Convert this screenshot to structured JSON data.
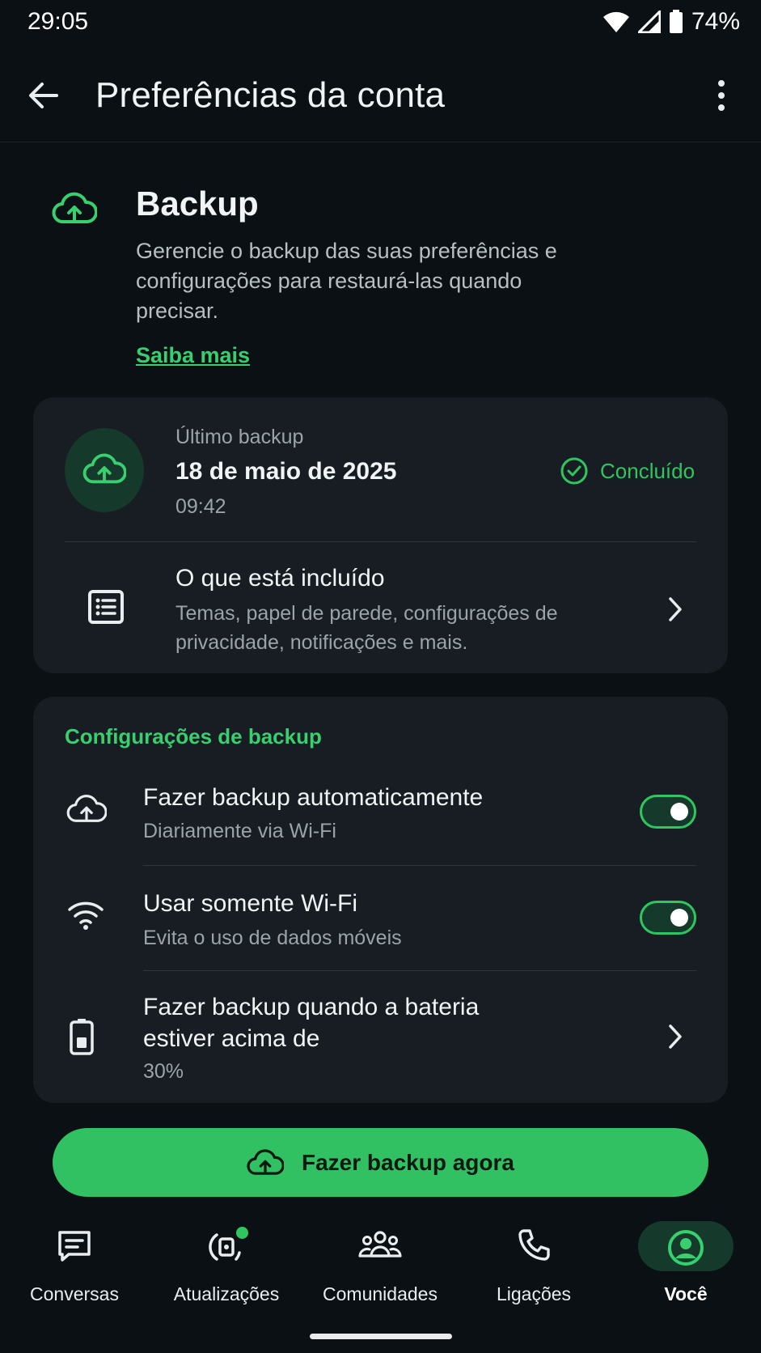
{
  "status_bar": {
    "time": "29:05",
    "battery_percent": "74%",
    "icons": [
      "wifi-icon",
      "signal-icon",
      "battery-icon"
    ]
  },
  "app_bar": {
    "title": "Preferências da conta",
    "back_icon": "arrow-left-icon",
    "menu_icon": "more-vert-icon"
  },
  "intro": {
    "icon": "cloud-upload-icon",
    "title": "Backup",
    "description": "Gerencie o backup das suas preferências e configurações para restaurá-las quando precisar.",
    "link": "Saiba mais"
  },
  "last_backup": {
    "label": "Último backup",
    "date": "18 de maio de 2025",
    "time": "09:42",
    "status": "Concluído",
    "included_title": "O que está incluído",
    "included_desc": "Temas, papel de parede, configurações de privacidade, notificações e mais."
  },
  "settings": {
    "section_title": "Configurações de backup",
    "auto_backup": {
      "title": "Fazer backup automaticamente",
      "subtitle": "Diariamente via Wi-Fi",
      "enabled": true
    },
    "wifi_only": {
      "title": "Usar somente Wi-Fi",
      "subtitle": "Evita o uso de dados móveis",
      "enabled": true
    },
    "battery": {
      "title": "Fazer backup quando a bateria estiver acima de",
      "value": "30%"
    }
  },
  "cta": {
    "label": "Fazer backup agora"
  },
  "bottom_nav": {
    "items": [
      {
        "label": "Conversas",
        "icon": "chats-icon"
      },
      {
        "label": "Atualizações",
        "icon": "updates-icon"
      },
      {
        "label": "Comunidades",
        "icon": "communities-icon"
      },
      {
        "label": "Ligações",
        "icon": "phone-icon"
      },
      {
        "label": "Você",
        "icon": "profile-icon",
        "selected": true
      }
    ]
  },
  "colors": {
    "accent": "#2fc65f",
    "background": "#0b1014",
    "card": "#171d22"
  }
}
